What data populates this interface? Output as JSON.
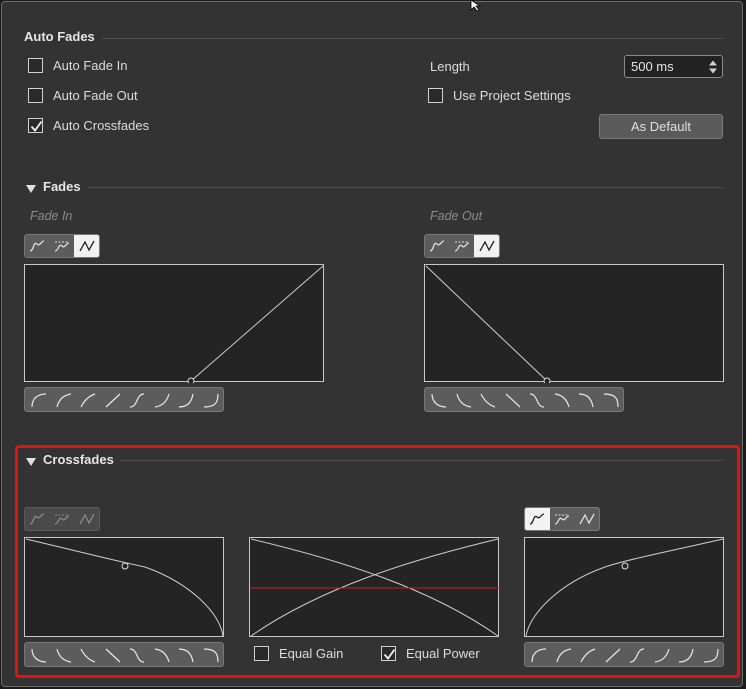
{
  "auto_fades": {
    "title": "Auto Fades",
    "fade_in": {
      "label": "Auto Fade In",
      "checked": false
    },
    "fade_out": {
      "label": "Auto Fade Out",
      "checked": false
    },
    "crossfades": {
      "label": "Auto Crossfades",
      "checked": true
    },
    "length_label": "Length",
    "length_value": "500 ms",
    "use_project": {
      "label": "Use Project Settings",
      "checked": false
    },
    "as_default": "As Default"
  },
  "fades": {
    "title": "Fades",
    "fade_in_label": "Fade In",
    "fade_out_label": "Fade Out"
  },
  "crossfades": {
    "title": "Crossfades",
    "equal_gain": {
      "label": "Equal Gain",
      "checked": false
    },
    "equal_power": {
      "label": "Equal Power",
      "checked": true
    }
  },
  "icons": {
    "collapse": "triangle-down-icon",
    "spline_mode": "spline-interpolation-icon",
    "damped_mode": "damped-spline-icon",
    "linear_mode": "linear-interpolation-icon",
    "spinner": "spinner-arrows-icon",
    "cursor": "mouse-pointer-icon"
  },
  "colors": {
    "panel": "#333333",
    "graph_bg": "#242424",
    "curve": "#cfcfcf",
    "accent_red": "#e0140f",
    "crossfade_line": "#cc1b1b"
  }
}
